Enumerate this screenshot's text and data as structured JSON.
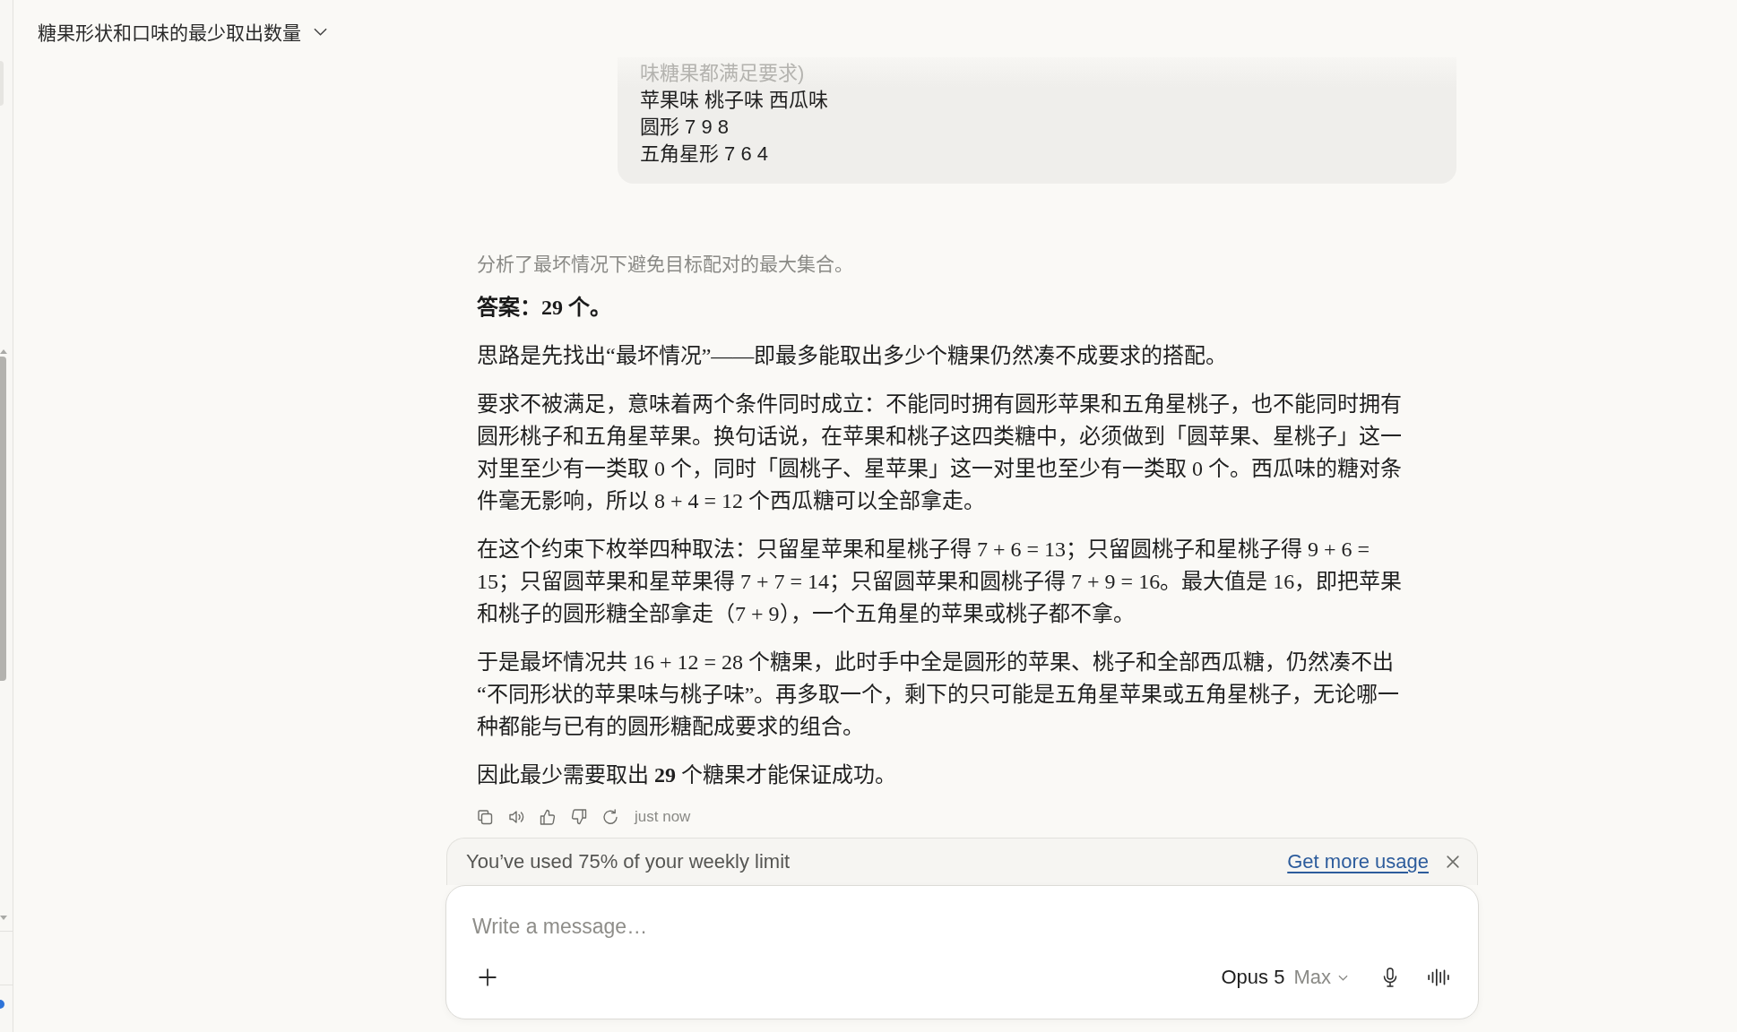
{
  "header": {
    "title": "糖果形状和口味的最少取出数量"
  },
  "user_message": {
    "lines": [
      "味糖果都满足要求)",
      "苹果味 桃子味 西瓜味",
      "圆形 7 9 8",
      "五角星形 7 6 4"
    ]
  },
  "assistant_message": {
    "thinking_summary": "分析了最坏情况下避免目标配对的最大集合。",
    "answer": "答案：29 个。",
    "paragraphs": [
      "思路是先找出“最坏情况”——即最多能取出多少个糖果仍然凑不成要求的搭配。",
      "要求不被满足，意味着两个条件同时成立：不能同时拥有圆形苹果和五角星桃子，也不能同时拥有圆形桃子和五角星苹果。换句话说，在苹果和桃子这四类糖中，必须做到「圆苹果、星桃子」这一对里至少有一类取 0 个，同时「圆桃子、星苹果」这一对里也至少有一类取 0 个。西瓜味的糖对条件毫无影响，所以 8 + 4 = 12 个西瓜糖可以全部拿走。",
      "在这个约束下枚举四种取法：只留星苹果和星桃子得 7 + 6 = 13；只留圆桃子和星桃子得 9 + 6 = 15；只留圆苹果和星苹果得 7 + 7 = 14；只留圆苹果和圆桃子得 7 + 9 = 16。最大值是 16，即把苹果和桃子的圆形糖全部拿走（7 + 9），一个五角星的苹果或桃子都不拿。",
      "于是最坏情况共 16 + 12 = 28 个糖果，此时手中全是圆形的苹果、桃子和全部西瓜糖，仍然凑不出“不同形状的苹果味与桃子味”。再多取一个，剩下的只可能是五角星苹果或五角星桃子，无论哪一种都能与已有的圆形糖配成要求的组合。",
      "因此最少需要取出 **29** 个糖果才能保证成功。"
    ],
    "timestamp": "just now"
  },
  "usage_banner": {
    "text": "You’ve used 75% of your weekly limit",
    "link": "Get more usage"
  },
  "composer": {
    "placeholder": "Write a message…",
    "model": "Opus 5",
    "mode": "Max"
  }
}
